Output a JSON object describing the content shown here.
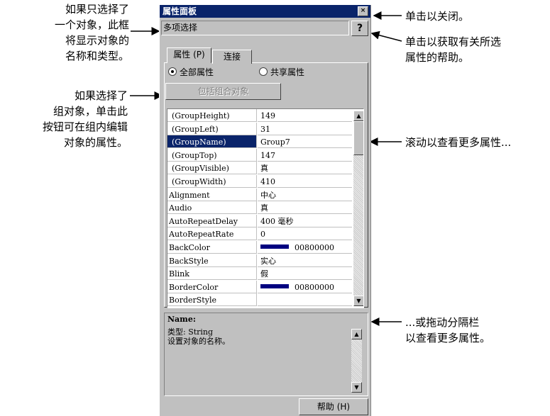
{
  "annotations": {
    "select_one": [
      "如果只选择了",
      "一个对象，此框",
      "将显示对象的",
      "名称和类型。"
    ],
    "group_select": [
      "如果选择了",
      "组对象，单击此",
      "按钮可在组内编辑",
      "对象的属性。"
    ],
    "close": "单击以关闭。",
    "help": [
      "单击以获取有关所选",
      "属性的帮助。"
    ],
    "scroll": "滚动以查看更多属性...",
    "drag": [
      "...或拖动分隔栏",
      "以查看更多属性。"
    ]
  },
  "panel": {
    "title": "属性面板",
    "close_glyph": "×",
    "object_field": "多项选择",
    "help_glyph": "?",
    "tabs": [
      "属性 (P)",
      "连接"
    ],
    "radio_all": "全部属性",
    "radio_shared": "共享属性",
    "group_button": "包括组合对象",
    "help_button": "帮助 (H)",
    "accent": "#0a246a"
  },
  "properties": [
    {
      "name": "(GroupHeight)",
      "value": "149"
    },
    {
      "name": "(GroupLeft)",
      "value": "31"
    },
    {
      "name": "(GroupName)",
      "value": "Group7"
    },
    {
      "name": "(GroupTop)",
      "value": "147"
    },
    {
      "name": "(GroupVisible)",
      "value": "真"
    },
    {
      "name": "(GroupWidth)",
      "value": "410"
    },
    {
      "name": "Alignment",
      "value": "中心"
    },
    {
      "name": "Audio",
      "value": "真"
    },
    {
      "name": "AutoRepeatDelay",
      "value": "400 毫秒"
    },
    {
      "name": "AutoRepeatRate",
      "value": "0"
    },
    {
      "name": "BackColor",
      "value": "00800000",
      "swatch": "#000080"
    },
    {
      "name": "BackStyle",
      "value": "实心"
    },
    {
      "name": "Blink",
      "value": "假"
    },
    {
      "name": "BorderColor",
      "value": "00800000",
      "swatch": "#000080"
    },
    {
      "name": "BorderStyle",
      "value": ""
    }
  ],
  "description": {
    "title": "Name:",
    "type_line": "类型: String",
    "text": "设置对象的名称。"
  }
}
